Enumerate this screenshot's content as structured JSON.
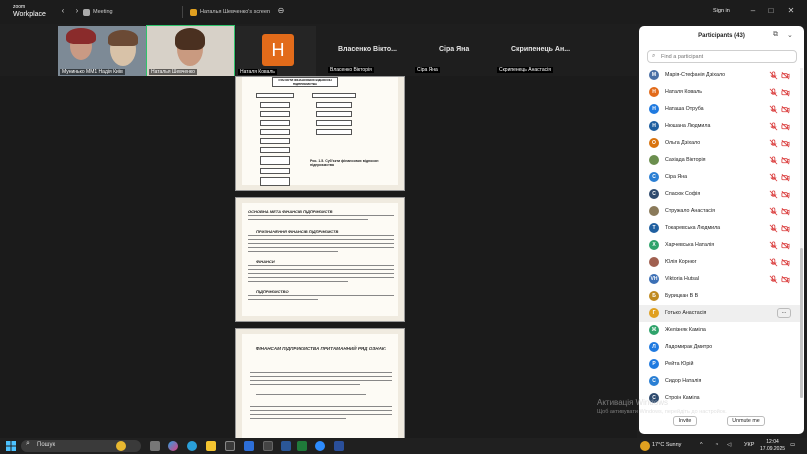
{
  "window": {
    "app_line1": "zoom",
    "app_line2": "Workplace",
    "tab_meeting": "Meeting",
    "tab_screen": "Наталья Шевченко's screen",
    "sign_in": "Sign in"
  },
  "strip": {
    "tiles": [
      {
        "name": "Мунинько ММ1 Надія Київ"
      },
      {
        "name": "Наталья Шевченко"
      },
      {
        "name": "Наталя Коваль"
      }
    ],
    "avatar_letter": "H",
    "big_names": [
      "Власенко Вікто...",
      "Сіра Яна",
      "Скрипенець Ан..."
    ],
    "sub_names": [
      "Власенко Вікторія",
      "Сіра Яна",
      "Скрипенець Анастасія"
    ]
  },
  "document": {
    "page1_header": "СУБ'ЄКТИ ФІНАНСОВИХ ВІДНОСИН ПІДПРИЄМСТВА",
    "page1_caption": "Рис. 1.5. Суб'єкти фінансових відносин підприємства",
    "page2_heading1": "ОСНОВНА МЕТА ФІНАНСІВ ПІДПРИЄМСТВ",
    "page2_heading2": "ПРИЗНАЧЕННЯ ФІНАНСІВ ПІДПРИЄМСТВ",
    "page2_heading3": "ФІНАНСИ",
    "page2_heading4": "ПІДПРИЄМСТВО",
    "page3_title": "ФІНАНСАМ ПІДПРИЄМСТВА ПРИТАМАННИЙ РЯД ОЗНАК:"
  },
  "participants": {
    "title": "Participants (43)",
    "search_placeholder": "Find a participant",
    "list": [
      {
        "name": "Марія-Стефанія Дзіхало",
        "initial": "M",
        "color": "#4a6fa5",
        "mic_muted": true,
        "cam_off": true
      },
      {
        "name": "Наталя Коваль",
        "initial": "H",
        "color": "#e26b1a",
        "mic_muted": true,
        "cam_off": true
      },
      {
        "name": "Наташа Отруба",
        "initial": "H",
        "color": "#1f7ae0",
        "mic_muted": true,
        "cam_off": true
      },
      {
        "name": "Нюшана Людмила",
        "initial": "H",
        "color": "#1f5fa0",
        "mic_muted": true,
        "cam_off": true
      },
      {
        "name": "Ольга Дзіхало",
        "initial": "O",
        "color": "#d9730d",
        "mic_muted": true,
        "cam_off": true
      },
      {
        "name": "Сахіада Вікторія",
        "initial": "",
        "color": "#6b8e4e",
        "mic_muted": true,
        "cam_off": true
      },
      {
        "name": "Сіра Яна",
        "initial": "C",
        "color": "#2a7fd4",
        "mic_muted": true,
        "cam_off": true
      },
      {
        "name": "Спасюк Софія",
        "initial": "C",
        "color": "#2e4a6e",
        "mic_muted": true,
        "cam_off": true
      },
      {
        "name": "Стружало Анастасія",
        "initial": "",
        "color": "#8a7a5a",
        "mic_muted": true,
        "cam_off": true
      },
      {
        "name": "Токаревська Людмила",
        "initial": "T",
        "color": "#1f5fa0",
        "mic_muted": true,
        "cam_off": true
      },
      {
        "name": "Харчевська Наталія",
        "initial": "X",
        "color": "#2fa36b",
        "mic_muted": true,
        "cam_off": true
      },
      {
        "name": "Юлія Корнюг",
        "initial": "",
        "color": "#a06050",
        "mic_muted": true,
        "cam_off": true
      },
      {
        "name": "Viktoria Hutsal",
        "initial": "VH",
        "color": "#3b6fb5",
        "mic_muted": true,
        "cam_off": true
      },
      {
        "name": "Бурицкан В В",
        "initial": "Б",
        "color": "#c08a20",
        "mic_muted": false,
        "cam_off": false
      },
      {
        "name": "Готько Анастасія",
        "initial": "Г",
        "color": "#e0a020",
        "mic_muted": false,
        "cam_off": false,
        "highlight": true
      },
      {
        "name": "Желізняк Каміла",
        "initial": "Ж",
        "color": "#2fa36b",
        "mic_muted": false,
        "cam_off": false
      },
      {
        "name": "Ладомирак Дмитро",
        "initial": "Л",
        "color": "#1f7ae0",
        "mic_muted": false,
        "cam_off": false
      },
      {
        "name": "Рейта Юрій",
        "initial": "P",
        "color": "#1f7ae0",
        "mic_muted": false,
        "cam_off": false
      },
      {
        "name": "Сидор Наталія",
        "initial": "C",
        "color": "#2a7fd4",
        "mic_muted": false,
        "cam_off": false
      },
      {
        "name": "Строін Каміла",
        "initial": "C",
        "color": "#2e4a6e",
        "mic_muted": false,
        "cam_off": false
      }
    ],
    "more_label": "...",
    "invite_label": "Invite",
    "unmute_label": "Unmute me"
  },
  "watermark": {
    "line1": "Активація Windows",
    "line2": "Щоб активувати Windows, перейдіть до настройок."
  },
  "taskbar": {
    "search_label": "Пошук",
    "weather": "17°C  Sunny",
    "lang": "УКР",
    "time": "12:04",
    "date": "17.09.2025"
  }
}
